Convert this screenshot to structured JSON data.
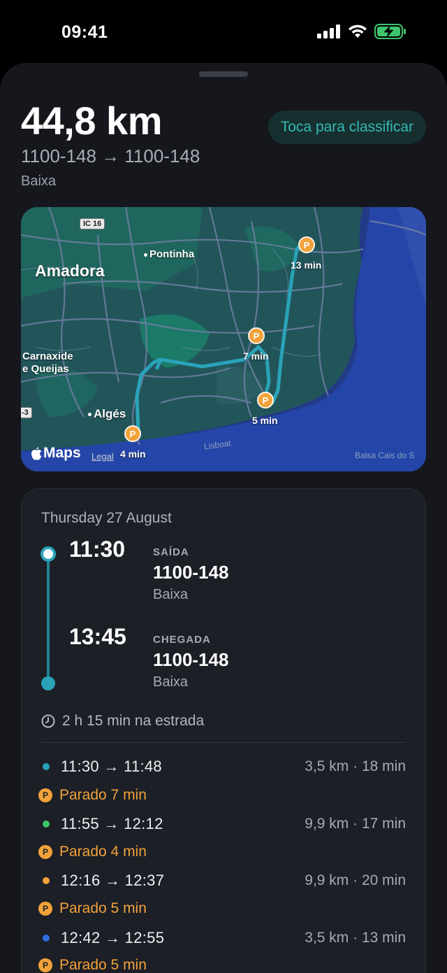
{
  "status": {
    "time": "09:41"
  },
  "trip": {
    "distance": "44,8 km",
    "route": "1100-148 → 1100-148",
    "area": "Baixa",
    "rate_label": "Toca para classificar"
  },
  "map": {
    "labels": {
      "amadora": "Amadora",
      "pontinha": "Pontinha",
      "carnaxide_1": "Carnaxide",
      "carnaxide_2": "e Queijas",
      "alges": "Algés",
      "lisboa": "Lisboat",
      "balsa": "Balsa Cais do S",
      "ic16": "IC 16",
      "a3": "-3",
      "maps": "Maps",
      "legal": "Legal"
    },
    "stops": [
      {
        "symbol": "P",
        "eta": "4 min"
      },
      {
        "symbol": "P",
        "eta": "5 min"
      },
      {
        "symbol": "P",
        "eta": "7 min"
      },
      {
        "symbol": "P",
        "eta": "13 min"
      }
    ],
    "colors": {
      "route": "#2aa3b9",
      "stop": "#f2a23a"
    }
  },
  "details": {
    "date": "Thursday 27 August",
    "departure": {
      "time": "11:30",
      "kind": "SAÍDA",
      "code": "1100-148",
      "place": "Baixa"
    },
    "arrival": {
      "time": "13:45",
      "kind": "CHEGADA",
      "code": "1100-148",
      "place": "Baixa"
    },
    "duration": "2 h 15 min na estrada",
    "segments": [
      {
        "time": "11:30 → 11:48",
        "meta": "3,5 km · 18 min",
        "color": "#2aa3b9"
      },
      {
        "time": "11:55 → 12:12",
        "meta": "9,9 km · 17 min",
        "color": "#3ec46d"
      },
      {
        "time": "12:16 → 12:37",
        "meta": "9,9 km · 20 min",
        "color": "#f2a23a"
      },
      {
        "time": "12:42 → 12:55",
        "meta": "3,5 km · 13 min",
        "color": "#2f6fe0"
      }
    ],
    "stops": [
      {
        "symbol": "P",
        "label": "Parado 7 min"
      },
      {
        "symbol": "P",
        "label": "Parado 4 min"
      },
      {
        "symbol": "P",
        "label": "Parado 5 min"
      },
      {
        "symbol": "P",
        "label": "Parado 5 min"
      }
    ]
  }
}
